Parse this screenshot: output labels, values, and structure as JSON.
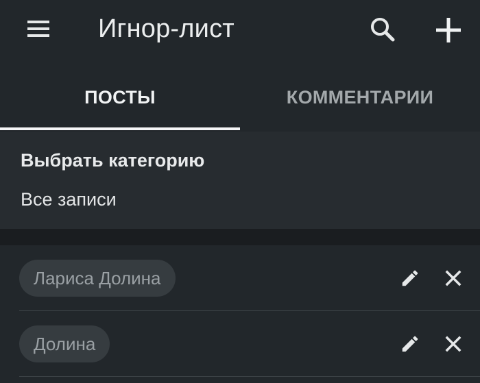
{
  "app_bar": {
    "title": "Игнор-лист",
    "menu_icon": "menu-icon",
    "search_icon": "search-icon",
    "add_icon": "plus-icon"
  },
  "tabs": [
    {
      "label": "ПОСТЫ",
      "selected": true
    },
    {
      "label": "КОММЕНТАРИИ",
      "selected": false
    }
  ],
  "category": {
    "label": "Выбрать категорию",
    "value": "Все записи"
  },
  "entries": [
    {
      "name": "Лариса Долина",
      "edit_icon": "pencil-icon",
      "delete_icon": "close-icon"
    },
    {
      "name": "Долина",
      "edit_icon": "pencil-icon",
      "delete_icon": "close-icon"
    }
  ],
  "colors": {
    "background": "#22272b",
    "category_background": "#272c30",
    "separator": "#1a1d20",
    "chip_background": "#363c40",
    "chip_text": "#9aa0a4",
    "icon": "#e6e8e9",
    "tab_indicator": "#f5f6f7"
  }
}
